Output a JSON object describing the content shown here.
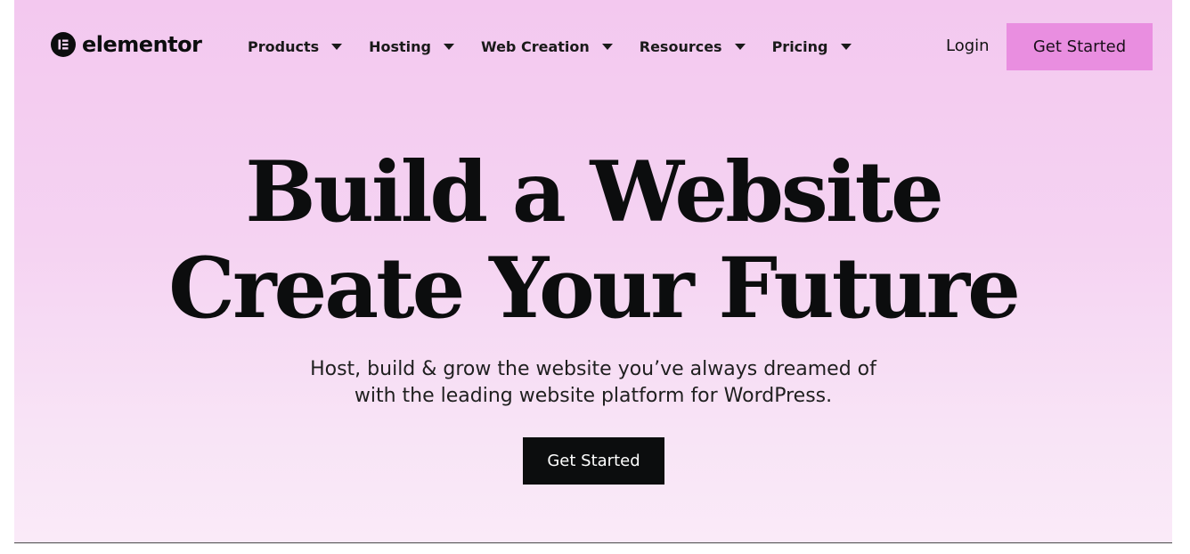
{
  "brand": {
    "name": "elementor",
    "logo_icon": "elementor-logo-icon"
  },
  "nav": {
    "items": [
      {
        "label": "Products",
        "icon": "chevron-down-icon"
      },
      {
        "label": "Hosting",
        "icon": "chevron-down-icon"
      },
      {
        "label": "Web Creation",
        "icon": "chevron-down-icon"
      },
      {
        "label": "Resources",
        "icon": "chevron-down-icon"
      },
      {
        "label": "Pricing",
        "icon": "chevron-down-icon"
      }
    ],
    "login_label": "Login",
    "cta_label": "Get Started"
  },
  "hero": {
    "title_line1": "Build a Website",
    "title_line2": "Create Your Future",
    "subtitle_line1": "Host, build & grow the website you’ve always dreamed of",
    "subtitle_line2": "with the leading website platform for WordPress.",
    "cta_label": "Get Started"
  },
  "colors": {
    "background_top": "#f3c8ef",
    "background_bottom": "#faeaf8",
    "header_cta": "#e98ee0",
    "hero_cta": "#0c0d0e",
    "text": "#0c0d0e"
  }
}
